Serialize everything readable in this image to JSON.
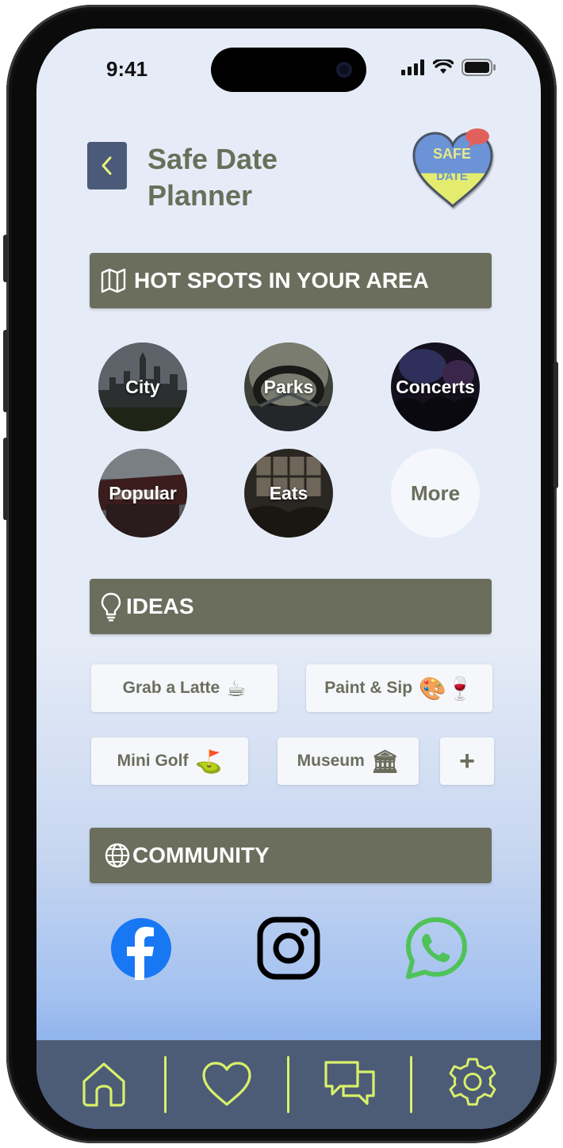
{
  "status_bar": {
    "time": "9:41"
  },
  "header": {
    "title": "Safe Date Planner",
    "logo": {
      "line1": "SAFE",
      "line2": "DATE"
    }
  },
  "hot_spots": {
    "heading": "HOT SPOTS IN YOUR AREA",
    "items": [
      {
        "label": "City"
      },
      {
        "label": "Parks"
      },
      {
        "label": "Concerts"
      },
      {
        "label": "Popular"
      },
      {
        "label": "Eats"
      },
      {
        "label": "More"
      }
    ]
  },
  "ideas": {
    "heading": "IDEAS",
    "items": [
      {
        "label": "Grab a Latte",
        "emoji": "☕"
      },
      {
        "label": "Paint & Sip",
        "emoji": "🎨🍷"
      },
      {
        "label": "Mini Golf",
        "emoji": "⛳"
      },
      {
        "label": "Museum",
        "emoji": "🏛"
      }
    ],
    "add_label": "+"
  },
  "community": {
    "heading": "COMMUNITY",
    "icons": [
      "facebook-icon",
      "instagram-icon",
      "whatsapp-icon"
    ]
  },
  "bottom_nav": {
    "icons": [
      "home-icon",
      "heart-icon",
      "chat-icon",
      "settings-icon"
    ]
  },
  "colors": {
    "section_bar": "#6b6e5d",
    "back_button": "#4b5a78",
    "title_text": "#67705a",
    "nav_background": "#4c5b76",
    "nav_accent": "#d8f06a",
    "facebook": "#1877f2",
    "whatsapp": "#4fc35a"
  }
}
